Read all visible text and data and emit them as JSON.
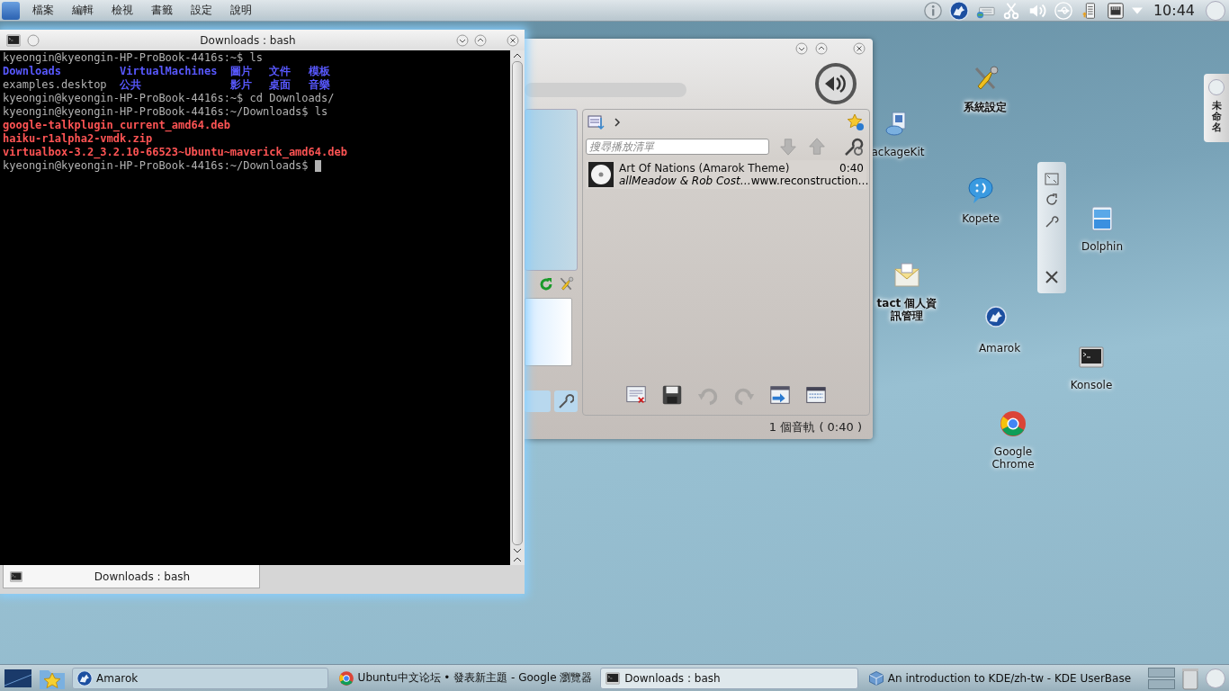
{
  "top_panel": {
    "menu": [
      {
        "label": "檔案"
      },
      {
        "label": "編輯"
      },
      {
        "label": "檢視"
      },
      {
        "label": "書籤"
      },
      {
        "label": "設定"
      },
      {
        "label": "說明"
      }
    ],
    "tray": [
      {
        "kind": "info"
      },
      {
        "kind": "wolf"
      },
      {
        "kind": "keyboard"
      },
      {
        "kind": "scissors"
      },
      {
        "kind": "volume"
      },
      {
        "kind": "usb"
      },
      {
        "kind": "battery"
      },
      {
        "kind": "network"
      },
      {
        "kind": "caret"
      }
    ],
    "clock": "10:44"
  },
  "terminal": {
    "title": "Downloads : bash",
    "lines": [
      {
        "kind": "text",
        "text": "kyeongin@kyeongin-HP-ProBook-4416s:~$ ls"
      },
      {
        "kind": "columns",
        "items": [
          {
            "text": "Downloads",
            "kind": "dir"
          },
          {
            "text": "VirtualMachines",
            "kind": "dir"
          },
          {
            "text": "圖片",
            "kind": "dir"
          },
          {
            "text": "文件",
            "kind": "dir"
          },
          {
            "text": "模板",
            "kind": "dir"
          }
        ]
      },
      {
        "kind": "columns",
        "items": [
          {
            "text": "examples.desktop",
            "kind": "file"
          },
          {
            "text": "公共",
            "kind": "dir"
          },
          {
            "text": "影片",
            "kind": "dir"
          },
          {
            "text": "桌面",
            "kind": "dir"
          },
          {
            "text": "音樂",
            "kind": "dir"
          }
        ]
      },
      {
        "kind": "text",
        "text": "kyeongin@kyeongin-HP-ProBook-4416s:~$ cd Downloads/"
      },
      {
        "kind": "text",
        "text": "kyeongin@kyeongin-HP-ProBook-4416s:~/Downloads$ ls"
      },
      {
        "kind": "package",
        "text": "google-talkplugin_current_amd64.deb"
      },
      {
        "kind": "package",
        "text": "haiku-r1alpha2-vmdk.zip"
      },
      {
        "kind": "package",
        "text": "virtualbox-3.2_3.2.10-66523~Ubuntu~maverick_amd64.deb"
      },
      {
        "kind": "text",
        "text": "kyeongin@kyeongin-HP-ProBook-4416s:~/Downloads$",
        "cursor": true
      }
    ],
    "tabs": [
      {
        "label": "Downloads : bash",
        "selected": true
      }
    ]
  },
  "amarok": {
    "search": {
      "placeholder": "搜尋播放清單"
    },
    "move_buttons": [
      {
        "kind": "down",
        "disabled": true
      },
      {
        "kind": "up",
        "disabled": true
      }
    ],
    "tracks": [
      {
        "title": "Art Of Nations (Amarok Theme)",
        "length": "0:40",
        "artist": "allMeadow & Rob Cost…",
        "album": "www.reconstruction…"
      }
    ],
    "toolbar": [
      {
        "kind": "clear",
        "disabled": false
      },
      {
        "kind": "save",
        "disabled": false
      },
      {
        "kind": "undo",
        "disabled": true
      },
      {
        "kind": "redo",
        "disabled": true
      },
      {
        "kind": "queue",
        "disabled": false
      },
      {
        "kind": "layout",
        "disabled": false
      }
    ],
    "status": "1 個音軌 ( 0:40 )"
  },
  "desktop_icons": [
    {
      "label": "系統設定",
      "kind": "tools"
    },
    {
      "label": "ackageKit",
      "kind": "package"
    },
    {
      "label": "Kopete",
      "kind": "chat"
    },
    {
      "label": "Dolphin",
      "kind": "cabinet"
    },
    {
      "label": "tact 個人資訊管理",
      "kind": "contact"
    },
    {
      "label": "Amarok",
      "kind": "wolf"
    },
    {
      "label": "Konsole",
      "kind": "terminal"
    },
    {
      "label": "Google Chrome",
      "kind": "wheel"
    }
  ],
  "side_tab": {
    "label": "未命名"
  },
  "taskbar": {
    "tasks": [
      {
        "label": "Amarok",
        "kind": "wolf",
        "selected": false,
        "raised": true
      },
      {
        "label": "Ubuntu中文论坛 • 發表新主題 - Google 瀏覽器",
        "kind": "wheel",
        "selected": false,
        "raised": false
      },
      {
        "label": "Downloads : bash",
        "kind": "terminal",
        "selected": true,
        "raised": false
      },
      {
        "label": "An introduction to KDE/zh-tw - KDE UserBase",
        "kind": "cube",
        "selected": false,
        "raised": false
      }
    ]
  }
}
